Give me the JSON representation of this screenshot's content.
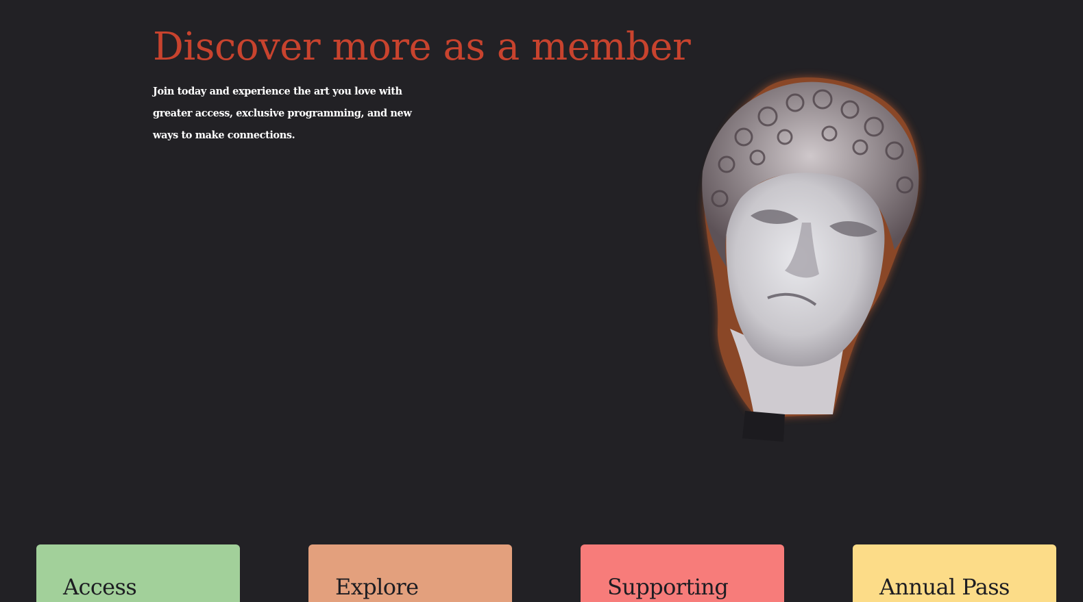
{
  "hero": {
    "title": "Discover more as a member",
    "description": "Join today and experience the art you love with greater access, exclusive programming, and new ways to make connections."
  },
  "image": {
    "icon": "marble-statue-head"
  },
  "membership_tiers": [
    {
      "title": "Access",
      "color": "#a2d09a"
    },
    {
      "title": "Explore",
      "color": "#e3a07d"
    },
    {
      "title": "Supporting",
      "color": "#f77c7a"
    },
    {
      "title": "Annual Pass",
      "color": "#fcdc88"
    }
  ],
  "colors": {
    "background": "#222125",
    "accent": "#c8432e",
    "text": "#ffffff"
  }
}
